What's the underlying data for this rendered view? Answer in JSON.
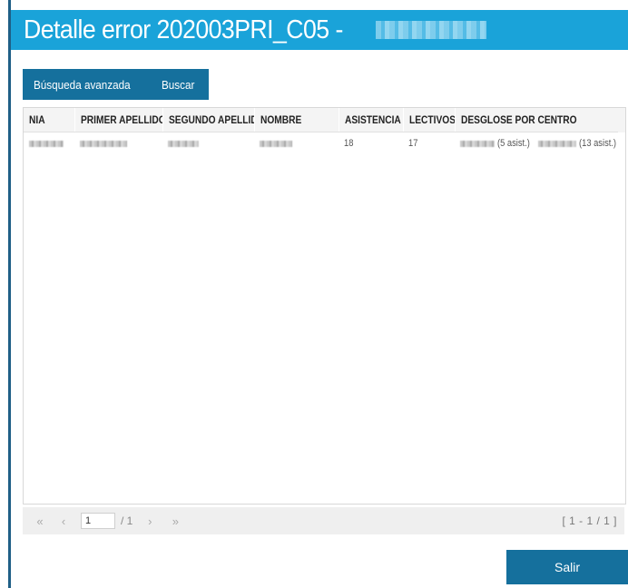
{
  "window": {
    "title": "Detalle error 202003PRI_C05 -"
  },
  "toolbar": {
    "advanced_search_label": "Búsqueda avanzada",
    "search_label": "Buscar"
  },
  "grid": {
    "columns": [
      "NIA",
      "PRIMER APELLIDO",
      "SEGUNDO APELLIDO",
      "NOMBRE",
      "ASISTENCIA",
      "LECTIVOS",
      "DESGLOSE POR CENTRO"
    ],
    "rows": [
      {
        "asistencia": "18",
        "lectivos": "17",
        "desglose_a": "(5 asist.)",
        "desglose_b": "(13 asist.)"
      }
    ]
  },
  "pager": {
    "first_icon": "«",
    "prev_icon": "‹",
    "next_icon": "›",
    "last_icon": "»",
    "current_page": "1",
    "total_pages": "/ 1",
    "range": "[ 1 - 1 / 1 ]"
  },
  "footer": {
    "exit_label": "Salir"
  },
  "colors": {
    "title_bar": "#1aa3d9",
    "accent": "#15709d"
  }
}
